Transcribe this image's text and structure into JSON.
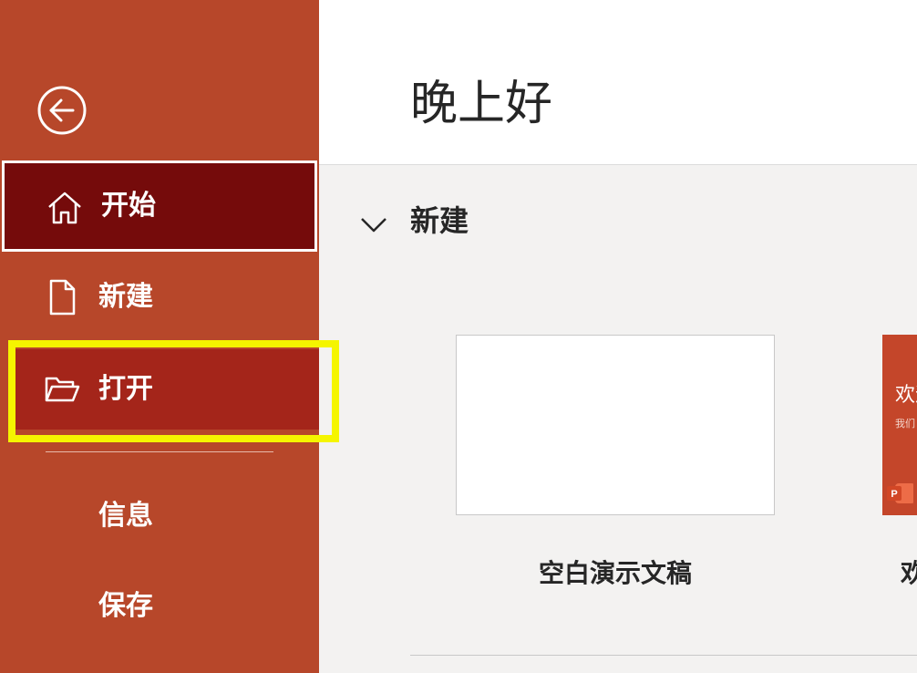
{
  "sidebar": {
    "items": [
      {
        "label": "开始",
        "icon": "home-icon"
      },
      {
        "label": "新建",
        "icon": "document-icon"
      },
      {
        "label": "打开",
        "icon": "folder-open-icon"
      },
      {
        "label": "信息"
      },
      {
        "label": "保存"
      }
    ],
    "active_item": "开始",
    "highlighted_item": "打开"
  },
  "main": {
    "greeting": "晚上好",
    "new_section": {
      "title": "新建",
      "templates": [
        {
          "label": "空白演示文稿"
        },
        {
          "label": "欢",
          "thumbnail_title": "欢迎",
          "thumbnail_subtitle": "我们"
        }
      ]
    }
  },
  "colors": {
    "sidebar_bg": "#b7472a",
    "active_item_bg": "#750b0b",
    "highlight_border": "#f5f500",
    "main_bg": "#f3f2f1"
  }
}
